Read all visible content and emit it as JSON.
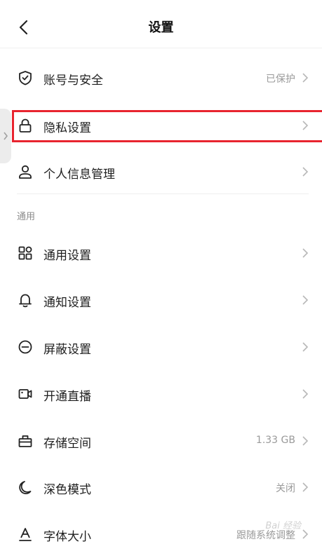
{
  "header": {
    "title": "设置"
  },
  "account_items": [
    {
      "label": "账号与安全",
      "value": "已保护",
      "icon": "shield-check-icon"
    },
    {
      "label": "隐私设置",
      "value": "",
      "icon": "lock-icon"
    },
    {
      "label": "个人信息管理",
      "value": "",
      "icon": "person-icon"
    }
  ],
  "general_section": {
    "title": "通用",
    "items": [
      {
        "label": "通用设置",
        "value": "",
        "icon": "grid-icon"
      },
      {
        "label": "通知设置",
        "value": "",
        "icon": "bell-icon"
      },
      {
        "label": "屏蔽设置",
        "value": "",
        "icon": "block-icon"
      },
      {
        "label": "开通直播",
        "value": "",
        "icon": "video-icon"
      },
      {
        "label": "存储空间",
        "value": "1.33 GB",
        "icon": "storage-icon"
      },
      {
        "label": "深色模式",
        "value": "关闭",
        "icon": "moon-icon"
      },
      {
        "label": "字体大小",
        "value": "跟随系统调整",
        "icon": "font-size-icon"
      }
    ]
  },
  "watermark": "Bai 经验",
  "colors": {
    "highlight": "#e8242f",
    "text": "#1f1f1f",
    "muted": "#9a9a9a"
  }
}
